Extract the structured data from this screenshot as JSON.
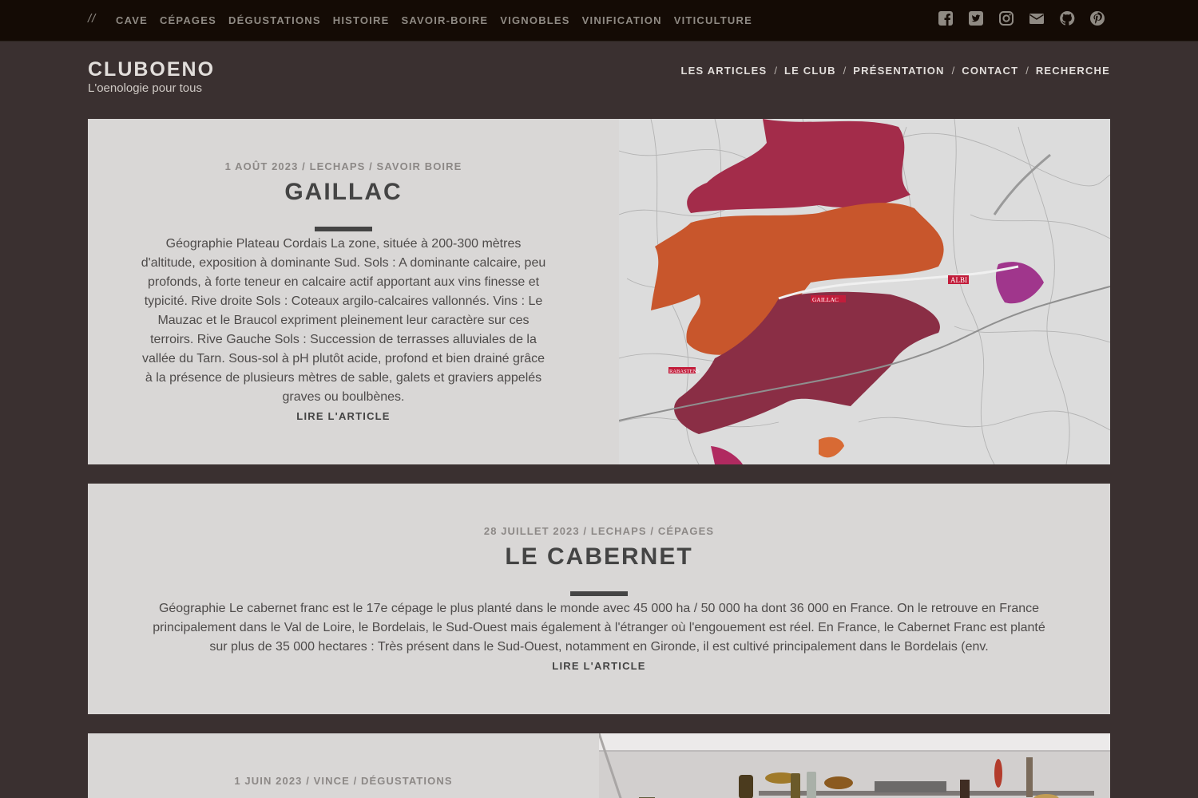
{
  "topbar": {
    "slashes": "//",
    "nav": [
      "CAVE",
      "CÉPAGES",
      "DÉGUSTATIONS",
      "HISTOIRE",
      "SAVOIR-BOIRE",
      "VIGNOBLES",
      "VINIFICATION",
      "VITICULTURE"
    ],
    "social_icons": [
      "facebook-icon",
      "twitter-icon",
      "instagram-icon",
      "envelope-icon",
      "github-icon",
      "pinterest-icon"
    ]
  },
  "site": {
    "title": "CLUBOENO",
    "tagline": "L'oenologie pour tous"
  },
  "mainnav": [
    "LES ARTICLES",
    "LE CLUB",
    "PRÉSENTATION",
    "CONTACT",
    "RECHERCHE"
  ],
  "mainnav_separator": "/",
  "posts": [
    {
      "date": "1 AOÛT 2023",
      "author": "LECHAPS",
      "category": "SAVOIR BOIRE",
      "title": "GAILLAC",
      "excerpt": "Géographie Plateau Cordais La zone, située à 200-300 mètres d'altitude, exposition à dominante Sud. Sols : A dominante calcaire, peu profonds, à forte teneur en calcaire actif apportant aux vins finesse et typicité. Rive droite Sols : Coteaux argilo-calcaires vallonnés. Vins : Le Mauzac et le Braucol expriment pleinement leur caractère sur ces terroirs. Rive Gauche Sols : Succession de terrasses alluviales de la vallée du Tarn. Sous-sol à pH plutôt acide, profond et bien drainé grâce à la présence de plusieurs mètres de sable, galets et graviers appelés graves ou boulbènes.",
      "more": "LIRE L'ARTICLE",
      "map_labels": {
        "city": "ALBI",
        "gaillac": "GAILLAC",
        "rabastens": "RABASTENS"
      }
    },
    {
      "date": "28 JUILLET 2023",
      "author": "LECHAPS",
      "category": "CÉPAGES",
      "title": "LE CABERNET",
      "excerpt": "Géographie Le cabernet franc est le 17e cépage le plus planté dans le monde avec 45 000 ha / 50 000 ha dont 36 000 en France. On le retrouve en France principalement dans le Val de Loire, le Bordelais, le Sud-Ouest mais également à l'étranger où l'engouement est réel. En France, le Cabernet Franc est planté sur plus de 35 000 hectares : Très présent dans le Sud-Ouest, notamment en Gironde, il est cultivé principalement dans le Bordelais (env.",
      "more": "LIRE L'ARTICLE"
    },
    {
      "date": "1 JUIN 2023",
      "author": "VINCE",
      "category": "DÉGUSTATIONS"
    }
  ],
  "meta_separator": "/",
  "colors": {
    "topbar": "#140b05",
    "background": "#3a3030",
    "card": "#d9d7d6",
    "map_magenta": "#a12b4b",
    "map_orange": "#c8562c",
    "map_burgundy": "#8a2e45",
    "map_purple": "#a0368c"
  }
}
